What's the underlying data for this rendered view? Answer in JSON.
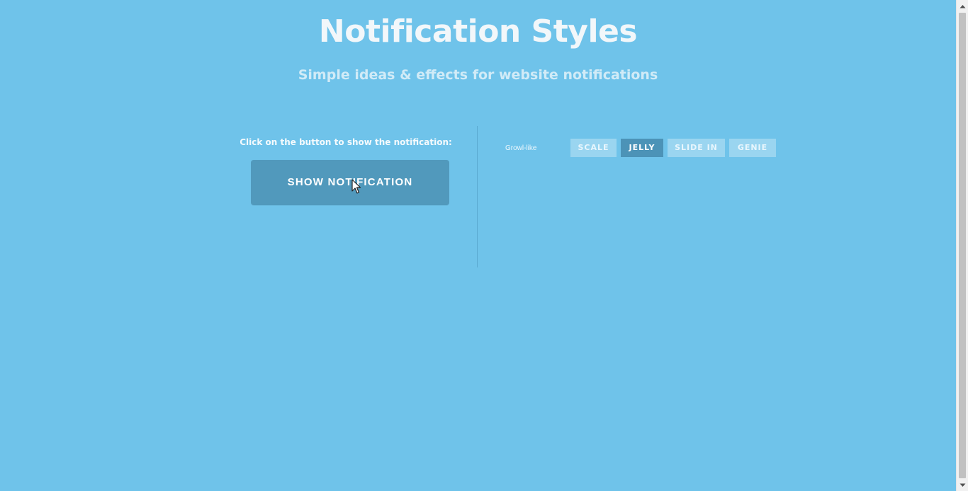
{
  "header": {
    "title": "Notification Styles",
    "subtitle": "Simple ideas & effects for website notifications"
  },
  "demo": {
    "instruction": "Click on the button to show the notification:",
    "show_button_label": "SHOW NOTIFICATION"
  },
  "styles_nav": {
    "current_style": "Growl-like",
    "effects": [
      {
        "label": "SCALE",
        "active": false
      },
      {
        "label": "JELLY",
        "active": true
      },
      {
        "label": "SLIDE IN",
        "active": false
      },
      {
        "label": "GENIE",
        "active": false
      }
    ]
  },
  "colors": {
    "background": "#6fc3ea",
    "button": "#5199bc",
    "effect_active": "#4c93b7",
    "effect_inactive": "#9ad5f0"
  },
  "icons": {
    "cursor": "mouse-pointer-icon",
    "scroll_up": "scroll-up-arrow-icon",
    "scroll_down": "scroll-down-arrow-icon"
  }
}
